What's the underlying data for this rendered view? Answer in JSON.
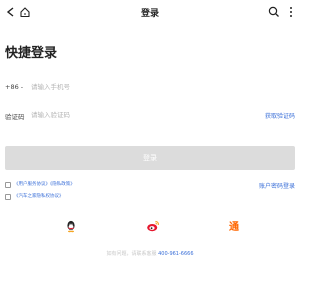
{
  "nav": {
    "title": "登录"
  },
  "page_title": "快捷登录",
  "phone": {
    "country_code": "+86 -",
    "placeholder": "请输入手机号"
  },
  "code": {
    "label": "验证码",
    "placeholder": "请输入验证码",
    "get_code": "获取验证码"
  },
  "login_button": "登录",
  "agreements": {
    "line1": "《用户服务协议》《隐私政策》",
    "line2": "《汽车之家隐私权协议》"
  },
  "account_login": "账户密码登录",
  "social": [
    "qq-icon",
    "weibo-icon",
    "tong-icon"
  ],
  "footer": {
    "text": "如有问题，请联系客服",
    "phone": "400-961-6666"
  },
  "colors": {
    "accent": "#3a6fd8",
    "button_disabled": "#dcdcdc",
    "qq": "#222222",
    "weibo": "#e6162d",
    "tong": "#ff6600"
  }
}
